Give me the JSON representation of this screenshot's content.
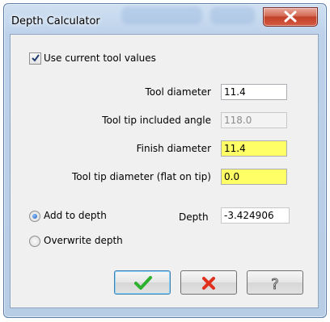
{
  "window": {
    "title": "Depth Calculator"
  },
  "use_current_tool": {
    "label": "Use current tool values",
    "checked": true
  },
  "fields": [
    {
      "label": "Tool diameter",
      "value": "11.4",
      "state": "normal"
    },
    {
      "label": "Tool tip included angle",
      "value": "118.0",
      "state": "disabled"
    },
    {
      "label": "Finish diameter",
      "value": "11.4",
      "state": "highlighted"
    },
    {
      "label": "Tool tip diameter (flat on tip)",
      "value": "0.0",
      "state": "highlighted"
    }
  ],
  "mode": {
    "options": [
      {
        "label": "Add to depth",
        "selected": true
      },
      {
        "label": "Overwrite depth",
        "selected": false
      }
    ]
  },
  "depth": {
    "label": "Depth",
    "value": "-3.424906"
  },
  "buttons": {
    "ok": "check-icon",
    "cancel": "x-icon",
    "help": "question-icon"
  },
  "colors": {
    "highlight_field": "#ffff66",
    "ok_green": "#2db02d",
    "cancel_red": "#e0301e"
  }
}
